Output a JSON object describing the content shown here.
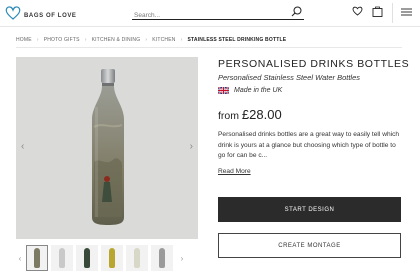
{
  "header": {
    "logo_text": "BAGS OF LOVE",
    "search_placeholder": "Search...",
    "icons": [
      "heart-icon",
      "basket-icon",
      "menu-icon",
      "search-icon"
    ]
  },
  "breadcrumb": [
    "HOME",
    "PHOTO GIFTS",
    "KITCHEN & DINING",
    "KITCHEN",
    "STAINLESS STEEL DRINKING BOTTLE"
  ],
  "product": {
    "title": "PERSONALISED DRINKS BOTTLES",
    "subtitle": "Personalised Stainless Steel Water Bottles",
    "made_in": "Made in the UK",
    "price_prefix": "from",
    "price": "£28.00",
    "description": "Personalised drinks bottles are a great way to easily tell which drink is yours at a glance but choosing which type of bottle to go for can be c...",
    "read_more": "Read More"
  },
  "buttons": {
    "start_design": "START DESIGN",
    "create_montage": "CREATE MONTAGE"
  },
  "gallery": {
    "thumb_count": 7,
    "active_thumb": 0
  },
  "colors": {
    "primary_button": "#2b2b2b",
    "gallery_bg": "#dadbd9"
  }
}
